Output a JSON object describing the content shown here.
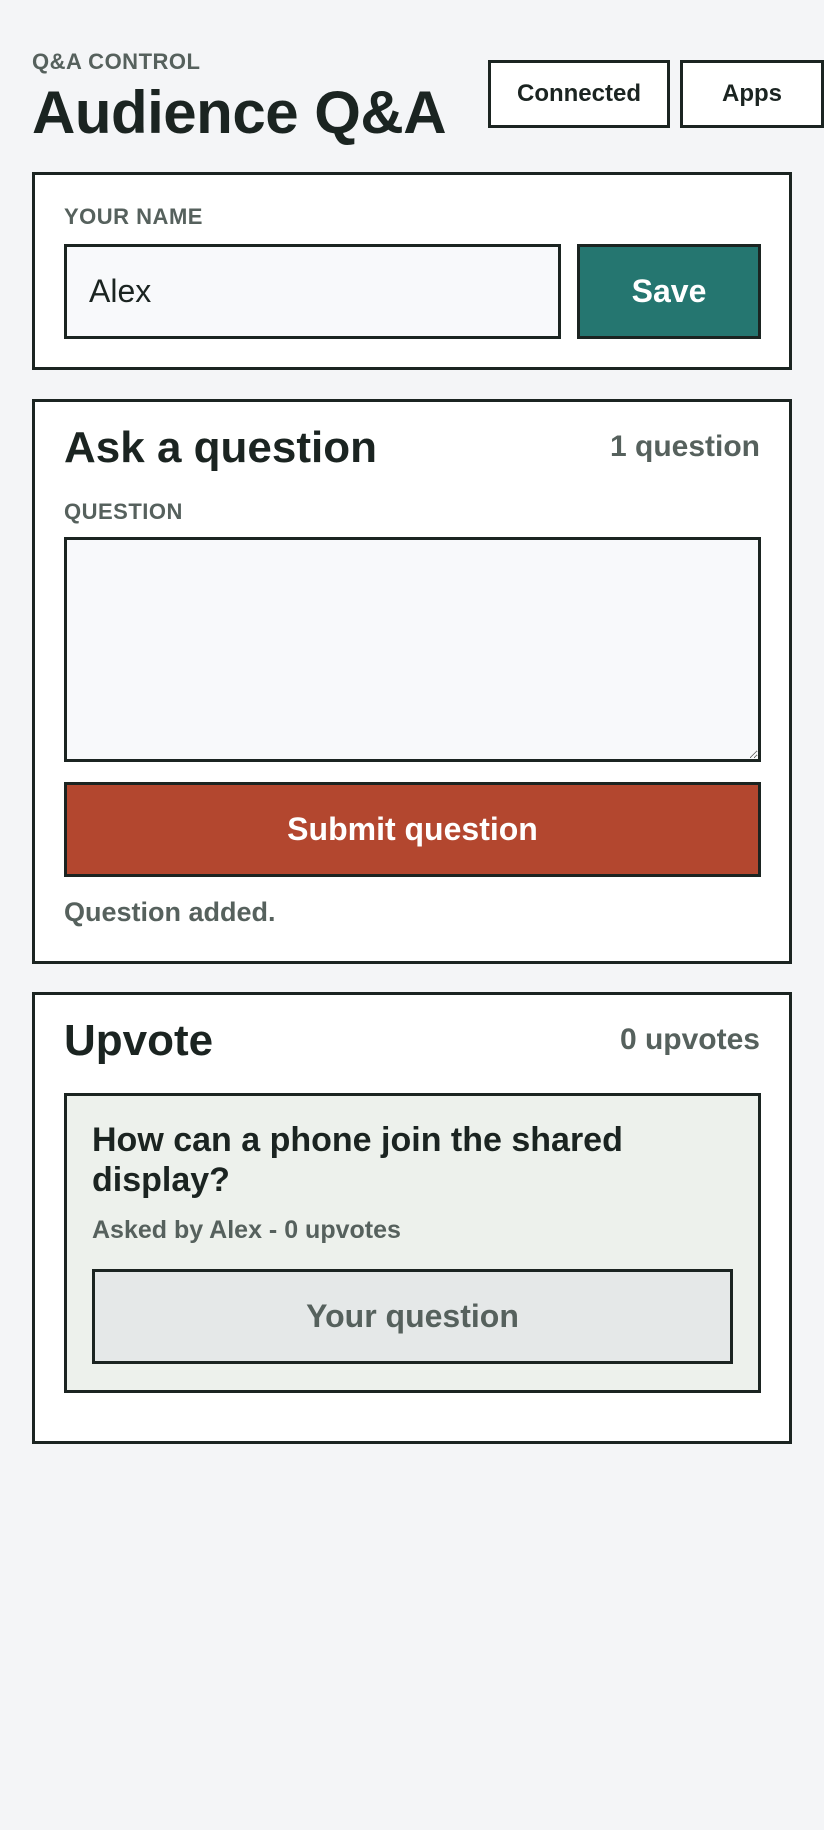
{
  "header": {
    "eyebrow": "Q&A CONTROL",
    "title": "Audience Q&A",
    "connected_label": "Connected",
    "apps_label": "Apps"
  },
  "name_card": {
    "label": "YOUR NAME",
    "name_value": "Alex",
    "save_label": "Save"
  },
  "ask_card": {
    "heading": "Ask a question",
    "count": "1 question",
    "question_label": "QUESTION",
    "question_value": "",
    "submit_label": "Submit question",
    "status": "Question added."
  },
  "upvote_card": {
    "heading": "Upvote",
    "count": "0 upvotes",
    "questions": [
      {
        "text": "How can a phone join the shared display?",
        "meta": "Asked by Alex - 0 upvotes",
        "action_label": "Your question"
      }
    ]
  },
  "colors": {
    "background": "#f4f5f7",
    "text": "#1b2421",
    "muted": "#56615d",
    "save_accent": "#257670",
    "submit_accent": "#b3472f",
    "question_bg": "#edf1ec"
  }
}
